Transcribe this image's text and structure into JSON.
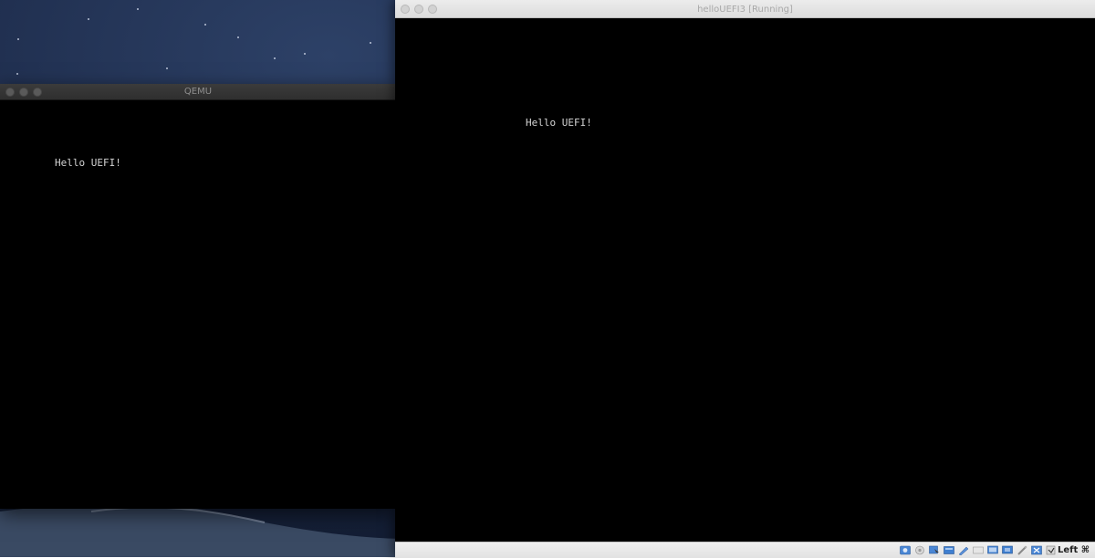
{
  "qemu_window": {
    "title": "QEMU",
    "screen_output": "Hello UEFI!"
  },
  "vbox_window": {
    "title": "helloUEFI3 [Running]",
    "screen_output": "Hello UEFI!",
    "status_bar": {
      "host_key_label": "Left ⌘",
      "icons": [
        "optical-drive-icon",
        "audio-icon",
        "usb-icon",
        "network-icon",
        "shared-folders-icon",
        "display-icon",
        "video-capture-icon",
        "cpu-icon",
        "mouse-integration-icon",
        "hdd-activity-icon",
        "keyboard-capture-icon"
      ]
    }
  }
}
